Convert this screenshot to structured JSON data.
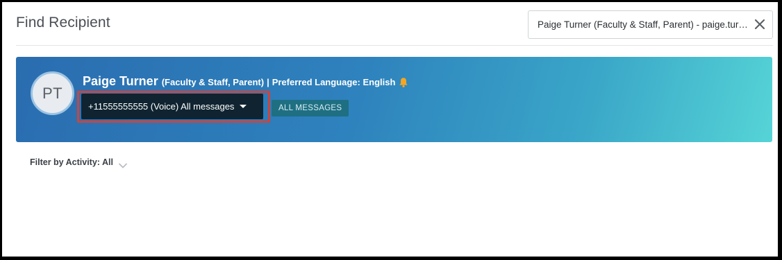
{
  "header": {
    "title": "Find Recipient",
    "search_value": "Paige Turner (Faculty & Staff, Parent) - paige.turner@..."
  },
  "recipient": {
    "initials": "PT",
    "name": "Paige Turner",
    "roles": "(Faculty & Staff, Parent)",
    "separator": "|",
    "preferred_language": "Preferred Language: English",
    "contact_selected": "+11555555555 (Voice) All messages",
    "badge": "ALL MESSAGES"
  },
  "filter": {
    "label": "Filter by Activity: All"
  },
  "icons": {
    "clear": "close-icon",
    "bell": "bell-icon",
    "dropdown": "caret-down-icon",
    "filter_chevron": "chevron-down-icon"
  },
  "colors": {
    "banner_start": "#2a6db0",
    "banner_end": "#55d4d6",
    "bell": "#f5a623",
    "highlight": "#c9453f",
    "select_bg": "#0f2430"
  }
}
